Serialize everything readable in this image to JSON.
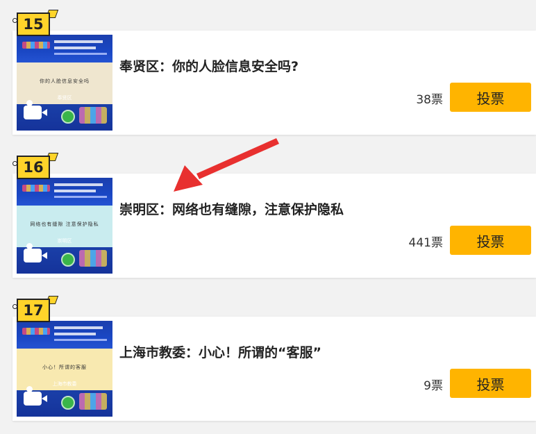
{
  "vote_button_label": "投票",
  "colors": {
    "button": "#ffb400",
    "badge": "#ffd42a",
    "arrow": "#e8302f",
    "page_background": "#f2f2f2"
  },
  "items": [
    {
      "rank": "15",
      "title": "奉贤区：你的人脸信息安全吗?",
      "votes": "38票",
      "thumb_region": "奉贤区",
      "thumb_caption": "你的人脸信息安全吗",
      "thumb_bg": "#efe6cf"
    },
    {
      "rank": "16",
      "title": "崇明区：网络也有缝隙，注意保护隐私",
      "votes": "441票",
      "thumb_region": "崇明区",
      "thumb_caption": "网络也有缝隙 注意保护隐私",
      "thumb_bg": "#c9ecef"
    },
    {
      "rank": "17",
      "title": "上海市教委：小心！所谓的“客服”",
      "votes": "9票",
      "thumb_region": "上海市教委",
      "thumb_caption": "小心！所谓的客服",
      "thumb_bg": "#f8e9b0"
    }
  ],
  "annotation": {
    "type": "arrow",
    "color": "#e8302f"
  }
}
